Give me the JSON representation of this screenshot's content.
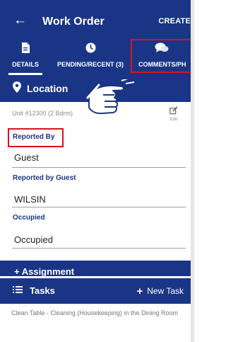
{
  "appbar": {
    "back_icon": "arrow-left-icon",
    "title": "Work Order",
    "create_label": "CREATE"
  },
  "tabs": [
    {
      "label": "DETAILS",
      "icon": "document-icon",
      "active": true
    },
    {
      "label": "PENDING/RECENT (3)",
      "icon": "clock-icon",
      "active": false
    },
    {
      "label": "COMMENTS/PH",
      "icon": "chat-icon",
      "active": false
    }
  ],
  "location": {
    "header": "Location",
    "unit": "Unit #12300 (2 Bdrm)",
    "edit_label": "Edit"
  },
  "fields": {
    "reported_by_label": "Reported By",
    "reported_by_value": "Guest",
    "reported_by_guest_label": "Reported by Guest",
    "reported_by_guest_value": "WILSIN",
    "occupied_label": "Occupied",
    "occupied_value": "Occupied"
  },
  "assignment": {
    "header": "+ Assignment"
  },
  "tasks": {
    "header": "Tasks",
    "new_task_label": "New Task",
    "items": [
      "Clean Table - Cleaning (Housekeeping) in the Dining Room"
    ]
  },
  "colors": {
    "primary": "#1a3585",
    "highlight": "#d8141b",
    "label": "#1a3585"
  }
}
